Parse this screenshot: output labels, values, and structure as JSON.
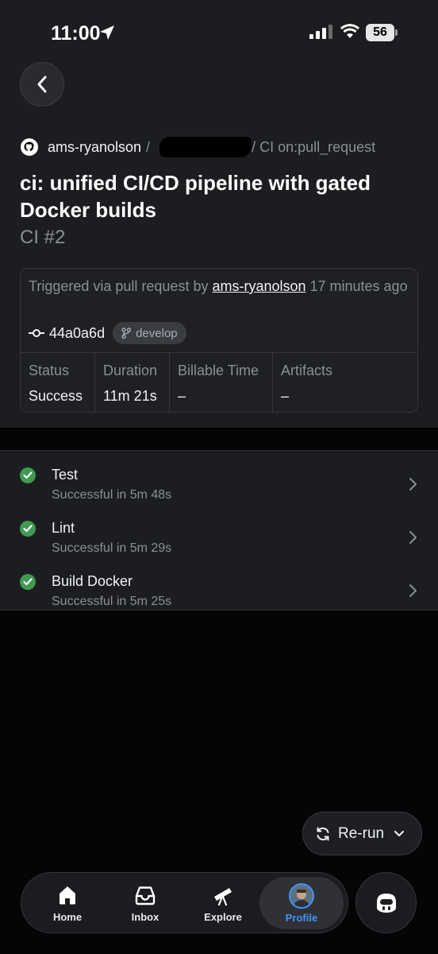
{
  "status_bar": {
    "time": "11:00",
    "battery": "56"
  },
  "repo": {
    "owner": "ams-ryanolson",
    "separator": "/",
    "workflow": "/ CI on:pull_request"
  },
  "run": {
    "title": "ci: unified CI/CD pipeline with gated Docker builds",
    "number": "CI #2"
  },
  "trigger": {
    "prefix": "Triggered via pull request by ",
    "user": "ams-ryanolson",
    "suffix": " 17 minutes ago",
    "commit": "44a0a6d",
    "branch": "develop"
  },
  "stats": [
    {
      "label": "Status",
      "value": "Success"
    },
    {
      "label": "Duration",
      "value": "11m 21s"
    },
    {
      "label": "Billable Time",
      "value": "–"
    },
    {
      "label": "Artifacts",
      "value": "–"
    }
  ],
  "jobs": [
    {
      "name": "Test",
      "status": "Successful in 5m 48s"
    },
    {
      "name": "Lint",
      "status": "Successful in 5m 29s"
    },
    {
      "name": "Build Docker",
      "status": "Successful in 5m 25s"
    }
  ],
  "rerun": {
    "label": "Re-run"
  },
  "tabs": [
    {
      "label": "Home",
      "icon": "home-icon"
    },
    {
      "label": "Inbox",
      "icon": "inbox-icon"
    },
    {
      "label": "Explore",
      "icon": "telescope-icon"
    },
    {
      "label": "Profile",
      "icon": "avatar",
      "active": true
    }
  ],
  "colors": {
    "accent": "#4493f8",
    "success": "#3f9a53",
    "background": "#1c1d20"
  }
}
